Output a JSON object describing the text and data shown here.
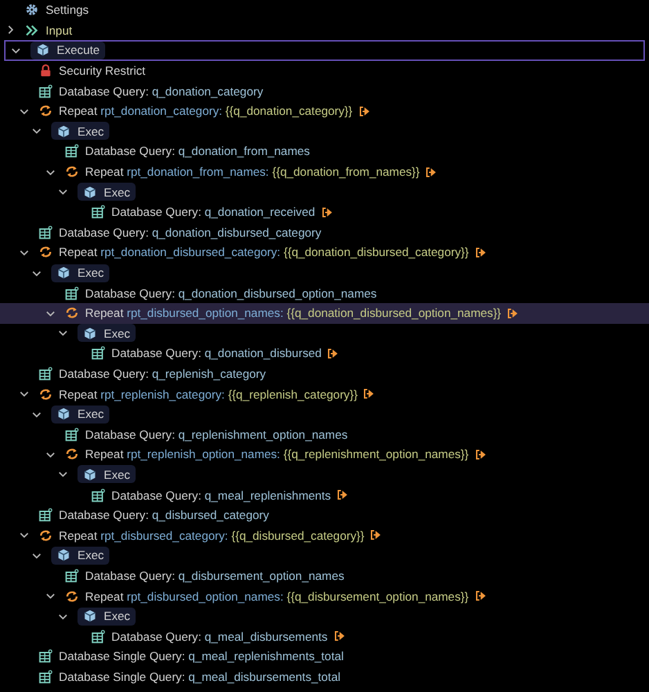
{
  "tree": [
    {
      "kind": "settings",
      "label": "Settings",
      "selected": false,
      "focused": false
    },
    {
      "kind": "input",
      "label": "Input",
      "expanded": false,
      "selected": false,
      "focused": false
    },
    {
      "kind": "execute",
      "label": "Execute",
      "expanded": true,
      "selected": false,
      "focused": true,
      "children": [
        {
          "kind": "security",
          "label": "Security Restrict",
          "selected": false,
          "focused": false
        },
        {
          "kind": "query",
          "label": "Database Query:",
          "name": "q_donation_category",
          "selected": false,
          "focused": false
        },
        {
          "kind": "repeat",
          "label": "Repeat",
          "name": "rpt_donation_category:",
          "value": "{{q_donation_category}}",
          "link": true,
          "expanded": true,
          "selected": false,
          "focused": false,
          "children": [
            {
              "kind": "exec",
              "label": "Exec",
              "expanded": true,
              "selected": false,
              "focused": false,
              "children": [
                {
                  "kind": "query",
                  "label": "Database Query:",
                  "name": "q_donation_from_names",
                  "selected": false,
                  "focused": false
                },
                {
                  "kind": "repeat",
                  "label": "Repeat",
                  "name": "rpt_donation_from_names:",
                  "value": "{{q_donation_from_names}}",
                  "link": true,
                  "expanded": true,
                  "selected": false,
                  "focused": false,
                  "children": [
                    {
                      "kind": "exec",
                      "label": "Exec",
                      "expanded": true,
                      "selected": false,
                      "focused": false,
                      "children": [
                        {
                          "kind": "query",
                          "label": "Database Query:",
                          "name": "q_donation_received",
                          "link": true,
                          "selected": false,
                          "focused": false
                        }
                      ]
                    }
                  ]
                }
              ]
            }
          ]
        },
        {
          "kind": "query",
          "label": "Database Query:",
          "name": "q_donation_disbursed_category",
          "selected": false,
          "focused": false
        },
        {
          "kind": "repeat",
          "label": "Repeat",
          "name": "rpt_donation_disbursed_category:",
          "value": "{{q_donation_disbursed_category}}",
          "link": true,
          "expanded": true,
          "selected": false,
          "focused": false,
          "children": [
            {
              "kind": "exec",
              "label": "Exec",
              "expanded": true,
              "selected": false,
              "focused": false,
              "children": [
                {
                  "kind": "query",
                  "label": "Database Query:",
                  "name": "q_donation_disbursed_option_names",
                  "selected": false,
                  "focused": false
                },
                {
                  "kind": "repeat",
                  "label": "Repeat",
                  "name": "rpt_disbursed_option_names:",
                  "value": "{{q_donation_disbursed_option_names}}",
                  "link": true,
                  "expanded": true,
                  "selected": true,
                  "focused": false,
                  "children": [
                    {
                      "kind": "exec",
                      "label": "Exec",
                      "expanded": true,
                      "selected": false,
                      "focused": false,
                      "children": [
                        {
                          "kind": "query",
                          "label": "Database Query:",
                          "name": "q_donation_disbursed",
                          "link": true,
                          "selected": false,
                          "focused": false
                        }
                      ]
                    }
                  ]
                }
              ]
            }
          ]
        },
        {
          "kind": "query",
          "label": "Database Query:",
          "name": "q_replenish_category",
          "selected": false,
          "focused": false
        },
        {
          "kind": "repeat",
          "label": "Repeat",
          "name": "rpt_replenish_category:",
          "value": "{{q_replenish_category}}",
          "link": true,
          "expanded": true,
          "selected": false,
          "focused": false,
          "children": [
            {
              "kind": "exec",
              "label": "Exec",
              "expanded": true,
              "selected": false,
              "focused": false,
              "children": [
                {
                  "kind": "query",
                  "label": "Database Query:",
                  "name": "q_replenishment_option_names",
                  "selected": false,
                  "focused": false
                },
                {
                  "kind": "repeat",
                  "label": "Repeat",
                  "name": "rpt_replenish_option_names:",
                  "value": "{{q_replenishment_option_names}}",
                  "link": true,
                  "expanded": true,
                  "selected": false,
                  "focused": false,
                  "children": [
                    {
                      "kind": "exec",
                      "label": "Exec",
                      "expanded": true,
                      "selected": false,
                      "focused": false,
                      "children": [
                        {
                          "kind": "query",
                          "label": "Database Query:",
                          "name": "q_meal_replenishments",
                          "link": true,
                          "selected": false,
                          "focused": false
                        }
                      ]
                    }
                  ]
                }
              ]
            }
          ]
        },
        {
          "kind": "query",
          "label": "Database Query:",
          "name": "q_disbursed_category",
          "selected": false,
          "focused": false
        },
        {
          "kind": "repeat",
          "label": "Repeat",
          "name": "rpt_disbursed_category:",
          "value": "{{q_disbursed_category}}",
          "link": true,
          "expanded": true,
          "selected": false,
          "focused": false,
          "children": [
            {
              "kind": "exec",
              "label": "Exec",
              "expanded": true,
              "selected": false,
              "focused": false,
              "children": [
                {
                  "kind": "query",
                  "label": "Database Query:",
                  "name": "q_disbursement_option_names",
                  "selected": false,
                  "focused": false
                },
                {
                  "kind": "repeat",
                  "label": "Repeat",
                  "name": "rpt_disbursed_option_names:",
                  "value": "{{q_disbursement_option_names}}",
                  "link": true,
                  "expanded": true,
                  "selected": false,
                  "focused": false,
                  "children": [
                    {
                      "kind": "exec",
                      "label": "Exec",
                      "expanded": true,
                      "selected": false,
                      "focused": false,
                      "children": [
                        {
                          "kind": "query",
                          "label": "Database Query:",
                          "name": "q_meal_disbursements",
                          "link": true,
                          "selected": false,
                          "focused": false
                        }
                      ]
                    }
                  ]
                }
              ]
            }
          ]
        },
        {
          "kind": "query",
          "label": "Database Single Query:",
          "name": "q_meal_replenishments_total",
          "selected": false,
          "focused": false
        },
        {
          "kind": "query",
          "label": "Database Single Query:",
          "name": "q_meal_disbursements_total",
          "selected": false,
          "focused": false
        }
      ]
    }
  ]
}
